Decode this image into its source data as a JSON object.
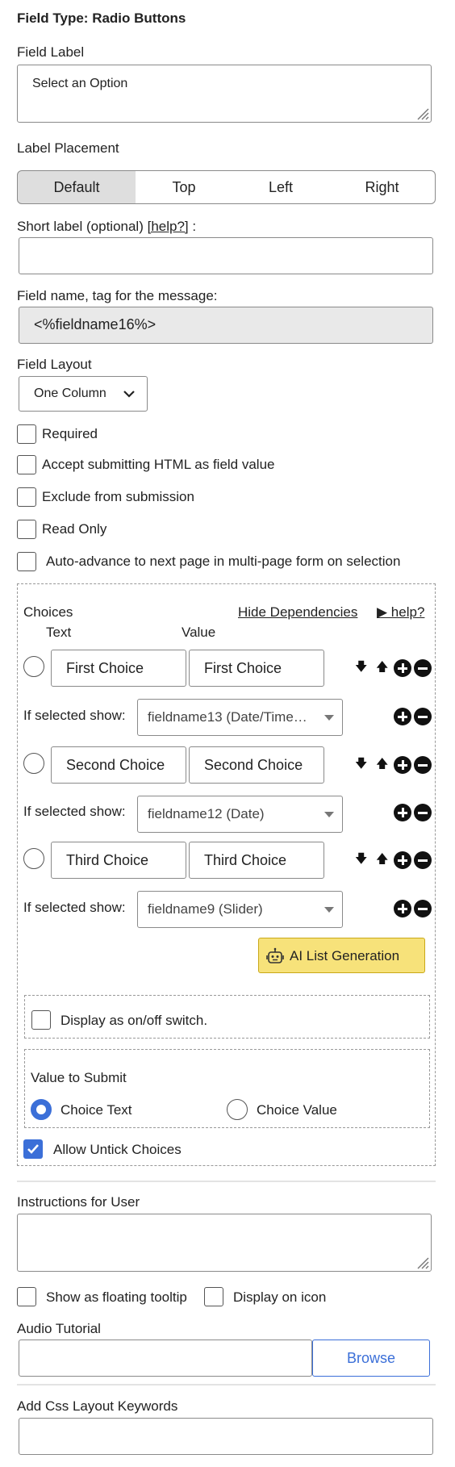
{
  "header": {
    "title": "Field Type: Radio Buttons"
  },
  "field_label": {
    "label": "Field Label",
    "value": "Select an Option"
  },
  "label_placement": {
    "label": "Label Placement",
    "options": [
      "Default",
      "Top",
      "Left",
      "Right"
    ],
    "selected": "Default"
  },
  "short_label": {
    "label": "Short label (optional)",
    "help": "[help?]",
    "suffix": ":",
    "value": ""
  },
  "field_name": {
    "label": "Field name, tag for the message:",
    "value": "<%fieldname16%>"
  },
  "field_layout": {
    "label": "Field Layout",
    "value": "One Column"
  },
  "checkboxes": {
    "required": "Required",
    "accept_html": "Accept submitting HTML as field value",
    "exclude": "Exclude from submission",
    "read_only": "Read Only",
    "auto_advance": "Auto-advance to next page in multi-page form on selection"
  },
  "choices": {
    "heading": "Choices",
    "hide_deps": "Hide Dependencies",
    "help": "▶ help?",
    "col_text": "Text",
    "col_value": "Value",
    "if_selected_label": "If selected show:",
    "items": [
      {
        "text": "First Choice",
        "value": "First Choice",
        "dependency": "fieldname13 (Date/Time…"
      },
      {
        "text": "Second Choice",
        "value": "Second Choice",
        "dependency": "fieldname12 (Date)"
      },
      {
        "text": "Third Choice",
        "value": "Third Choice",
        "dependency": "fieldname9 (Slider)"
      }
    ],
    "ai_button": "AI List Generation",
    "switch_label": "Display as on/off switch.",
    "value_to_submit": {
      "label": "Value to Submit",
      "option_text": "Choice Text",
      "option_value": "Choice Value",
      "selected": "Choice Text"
    },
    "allow_untick": "Allow Untick Choices"
  },
  "instructions": {
    "label": "Instructions for User",
    "value": ""
  },
  "tooltip": {
    "floating": "Show as floating tooltip",
    "on_icon": "Display on icon"
  },
  "audio": {
    "label": "Audio Tutorial",
    "browse": "Browse"
  },
  "css": {
    "label": "Add Css Layout Keywords"
  },
  "colors": {
    "accent": "#3b6fd8",
    "ai_button_bg": "#f7e27a",
    "readonly_bg": "#e9e9e9",
    "selected_seg_bg": "#dedede"
  }
}
